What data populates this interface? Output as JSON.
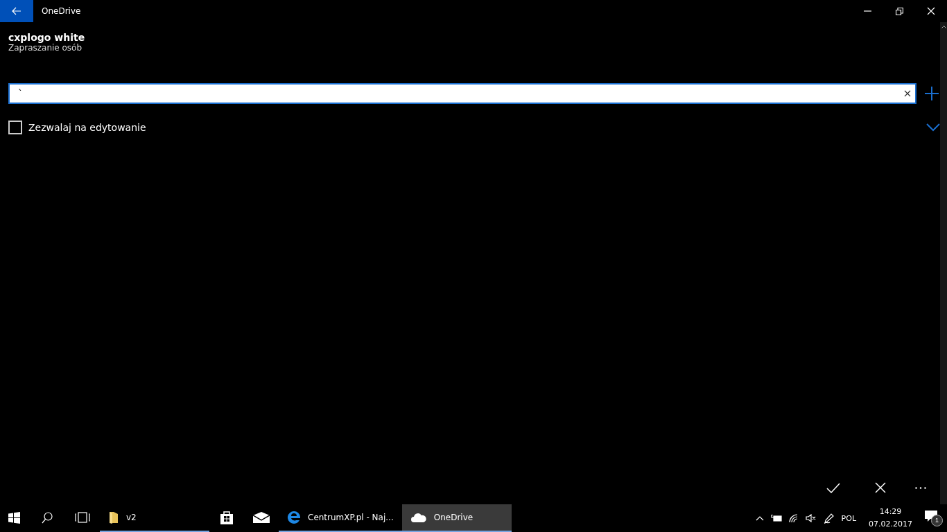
{
  "window": {
    "title": "OneDrive"
  },
  "header": {
    "title": "cxplogo white",
    "subtitle": "Zapraszanie osób"
  },
  "invite_field": {
    "value": "`"
  },
  "allow_editing": {
    "label": "Zezwalaj na edytowanie",
    "checked": false
  },
  "taskbar": {
    "apps": [
      {
        "kind": "folder",
        "label": "v2",
        "running": true,
        "active": false
      },
      {
        "kind": "store",
        "running": false,
        "active": false
      },
      {
        "kind": "mail",
        "running": false,
        "active": false
      },
      {
        "kind": "edge",
        "label": "CentrumXP.pl - Naj...",
        "running": true,
        "active": false
      },
      {
        "kind": "cloud",
        "label": "OneDrive",
        "running": true,
        "active": true
      }
    ],
    "language": "POL",
    "time": "14:29",
    "date": "07.02.2017",
    "notification_count": "1"
  }
}
